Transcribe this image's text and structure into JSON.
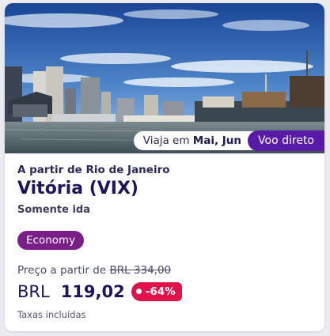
{
  "card": {
    "image": {
      "name": "vitoria-harbor-photo",
      "colors": {
        "sky_top": "#1f4fa0",
        "sky_bottom": "#8fb6de",
        "water": "#6f7f86"
      }
    },
    "travel_chip": {
      "prefix": "Viaja em",
      "months": "Mai, Jun"
    },
    "direct_chip": {
      "label": "Voo direto",
      "color": "#5a1aa8"
    },
    "origin": "A partir de Rio de Janeiro",
    "destination": "Vitória (VIX)",
    "trip_type": "Somente ida",
    "cabin": {
      "label": "Economy",
      "color": "#7a1f88"
    },
    "price": {
      "from_label": "Preço a partir de",
      "old_price": "BRL  334,00",
      "currency": "BRL",
      "amount": "119,02",
      "discount": "-64%",
      "discount_color": "#e0134a",
      "taxes_note": "Taxas incluídas"
    }
  }
}
